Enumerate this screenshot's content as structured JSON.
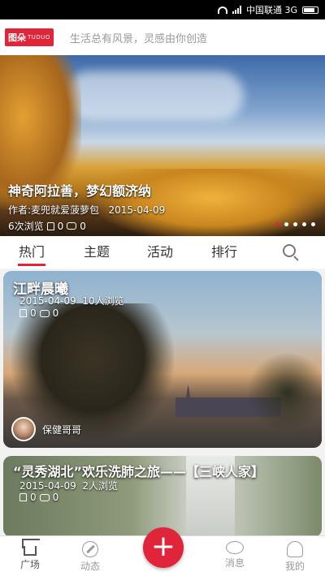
{
  "status_bar": {
    "carrier": "中国联通 3G"
  },
  "header": {
    "logo_cn": "图朵",
    "logo_en": "TUDUO",
    "slogan": "生活总有风景，灵感由你创造"
  },
  "banner": {
    "title": "神奇阿拉善，梦幻额济纳",
    "author_label": "作者:",
    "author": "麦兜就爱菠萝包",
    "date": "2015-04-09",
    "views": "6次浏览",
    "likes": "0",
    "comments": "0",
    "dots": 5,
    "active_dot": 0
  },
  "tabs": [
    {
      "label": "热门",
      "active": true
    },
    {
      "label": "主题",
      "active": false
    },
    {
      "label": "活动",
      "active": false
    },
    {
      "label": "排行",
      "active": false
    }
  ],
  "cards": [
    {
      "title": "江畔晨曦",
      "date": "2015-04-09",
      "views": "10人浏览",
      "likes": "0",
      "comments": "0",
      "author": "保健哥哥"
    },
    {
      "title": "“灵秀湖北”欢乐洗肺之旅——【三峡人家】",
      "date": "2015-04-09",
      "views": "2人浏览",
      "likes": "0",
      "comments": "0"
    }
  ],
  "bottom_nav": {
    "home": "广场",
    "discover": "动态",
    "add": "+",
    "messages": "消息",
    "me": "我的"
  },
  "colors": {
    "accent": "#e0243a"
  }
}
